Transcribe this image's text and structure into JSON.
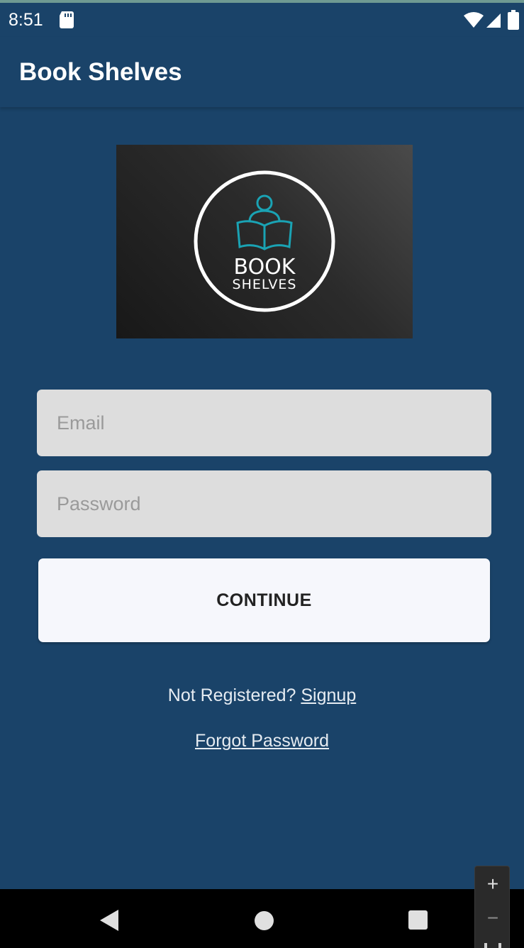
{
  "status_bar": {
    "time": "8:51"
  },
  "app_bar": {
    "title": "Book Shelves"
  },
  "logo": {
    "line1": "BOOK",
    "line2": "SHELVES"
  },
  "form": {
    "email_placeholder": "Email",
    "password_placeholder": "Password",
    "continue_label": "CONTINUE"
  },
  "links": {
    "not_registered_text": "Not Registered?",
    "signup_label": "Signup",
    "forgot_password_label": "Forgot Password"
  },
  "zoom": {
    "zoom_in_label": "+",
    "zoom_out_label": "−"
  },
  "colors": {
    "background": "#1a4369",
    "field": "#dddddd",
    "button": "#f6f7fc",
    "logo_accent": "#1aa3b4"
  },
  "icons": {
    "status": [
      "sd-card-icon",
      "wifi-icon",
      "signal-icon",
      "battery-icon"
    ],
    "nav": [
      "back-icon",
      "home-icon",
      "recents-icon"
    ]
  }
}
